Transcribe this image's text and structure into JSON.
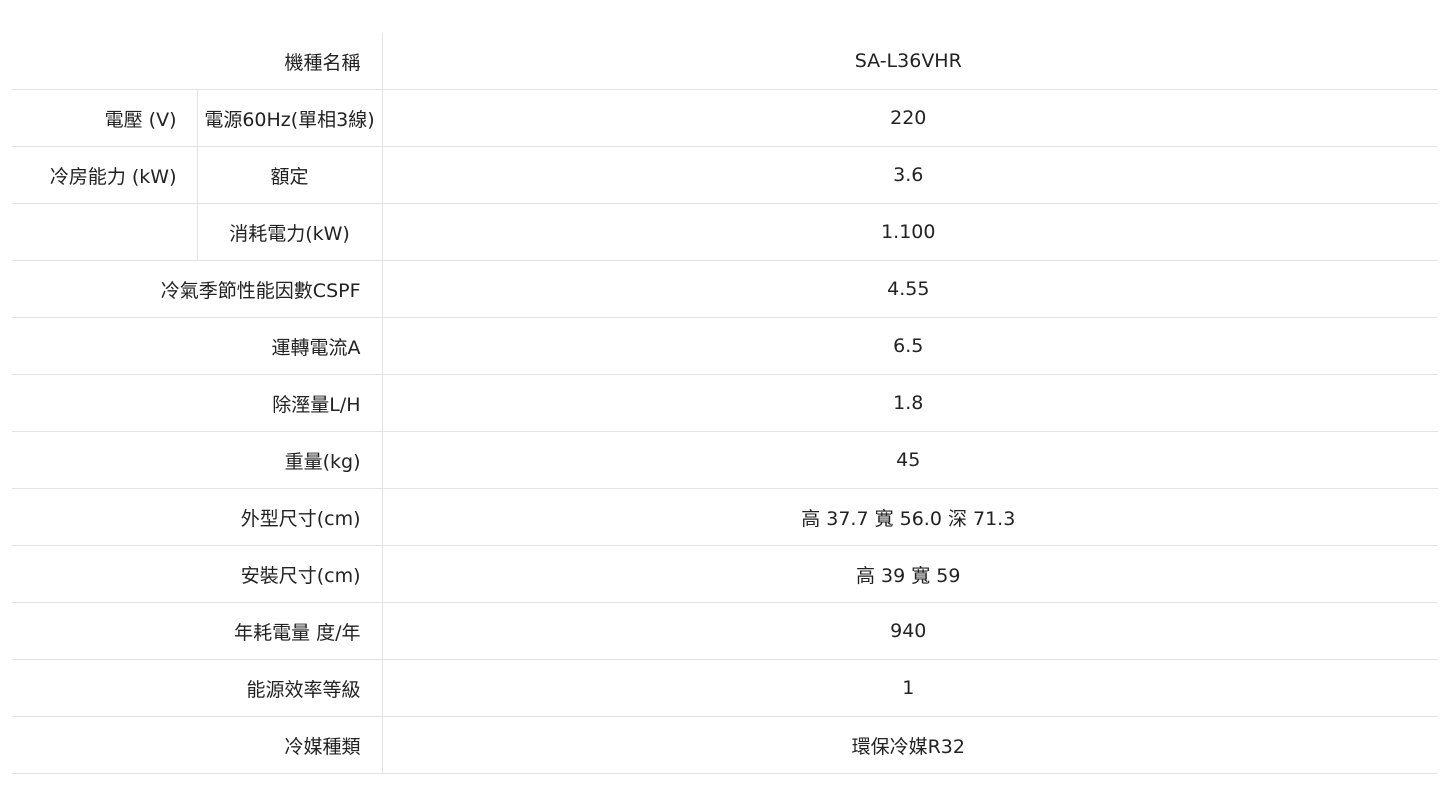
{
  "spec_table": {
    "rows": [
      {
        "label": "機種名稱",
        "value": "SA-L36VHR"
      },
      {
        "group": "電壓 (V)",
        "sub": "電源60Hz(單相3線)",
        "value": "220"
      },
      {
        "group": "冷房能力 (kW)",
        "sub": "額定",
        "value": "3.6"
      },
      {
        "group": "",
        "sub": "消耗電力(kW)",
        "value": "1.100"
      },
      {
        "label": "冷氣季節性能因數CSPF",
        "value": "4.55"
      },
      {
        "label": "運轉電流A",
        "value": "6.5"
      },
      {
        "label": "除溼量L/H",
        "value": "1.8"
      },
      {
        "label": "重量(kg)",
        "value": "45"
      },
      {
        "label": "外型尺寸(cm)",
        "value": "高 37.7 寬 56.0 深 71.3"
      },
      {
        "label": "安裝尺寸(cm)",
        "value": "高 39 寬 59"
      },
      {
        "label": "年耗電量 度/年",
        "value": "940"
      },
      {
        "label": "能源效率等級",
        "value": "1"
      },
      {
        "label": "冷媒種類",
        "value": "環保冷媒R32"
      }
    ]
  }
}
